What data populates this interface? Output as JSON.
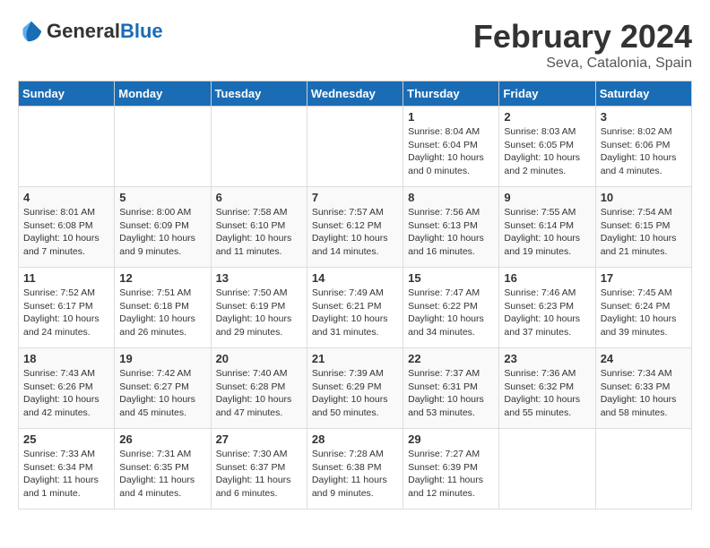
{
  "header": {
    "logo_general": "General",
    "logo_blue": "Blue",
    "title": "February 2024",
    "subtitle": "Seva, Catalonia, Spain"
  },
  "weekdays": [
    "Sunday",
    "Monday",
    "Tuesday",
    "Wednesday",
    "Thursday",
    "Friday",
    "Saturday"
  ],
  "weeks": [
    [
      {
        "day": "",
        "info": ""
      },
      {
        "day": "",
        "info": ""
      },
      {
        "day": "",
        "info": ""
      },
      {
        "day": "",
        "info": ""
      },
      {
        "day": "1",
        "info": "Sunrise: 8:04 AM\nSunset: 6:04 PM\nDaylight: 10 hours\nand 0 minutes."
      },
      {
        "day": "2",
        "info": "Sunrise: 8:03 AM\nSunset: 6:05 PM\nDaylight: 10 hours\nand 2 minutes."
      },
      {
        "day": "3",
        "info": "Sunrise: 8:02 AM\nSunset: 6:06 PM\nDaylight: 10 hours\nand 4 minutes."
      }
    ],
    [
      {
        "day": "4",
        "info": "Sunrise: 8:01 AM\nSunset: 6:08 PM\nDaylight: 10 hours\nand 7 minutes."
      },
      {
        "day": "5",
        "info": "Sunrise: 8:00 AM\nSunset: 6:09 PM\nDaylight: 10 hours\nand 9 minutes."
      },
      {
        "day": "6",
        "info": "Sunrise: 7:58 AM\nSunset: 6:10 PM\nDaylight: 10 hours\nand 11 minutes."
      },
      {
        "day": "7",
        "info": "Sunrise: 7:57 AM\nSunset: 6:12 PM\nDaylight: 10 hours\nand 14 minutes."
      },
      {
        "day": "8",
        "info": "Sunrise: 7:56 AM\nSunset: 6:13 PM\nDaylight: 10 hours\nand 16 minutes."
      },
      {
        "day": "9",
        "info": "Sunrise: 7:55 AM\nSunset: 6:14 PM\nDaylight: 10 hours\nand 19 minutes."
      },
      {
        "day": "10",
        "info": "Sunrise: 7:54 AM\nSunset: 6:15 PM\nDaylight: 10 hours\nand 21 minutes."
      }
    ],
    [
      {
        "day": "11",
        "info": "Sunrise: 7:52 AM\nSunset: 6:17 PM\nDaylight: 10 hours\nand 24 minutes."
      },
      {
        "day": "12",
        "info": "Sunrise: 7:51 AM\nSunset: 6:18 PM\nDaylight: 10 hours\nand 26 minutes."
      },
      {
        "day": "13",
        "info": "Sunrise: 7:50 AM\nSunset: 6:19 PM\nDaylight: 10 hours\nand 29 minutes."
      },
      {
        "day": "14",
        "info": "Sunrise: 7:49 AM\nSunset: 6:21 PM\nDaylight: 10 hours\nand 31 minutes."
      },
      {
        "day": "15",
        "info": "Sunrise: 7:47 AM\nSunset: 6:22 PM\nDaylight: 10 hours\nand 34 minutes."
      },
      {
        "day": "16",
        "info": "Sunrise: 7:46 AM\nSunset: 6:23 PM\nDaylight: 10 hours\nand 37 minutes."
      },
      {
        "day": "17",
        "info": "Sunrise: 7:45 AM\nSunset: 6:24 PM\nDaylight: 10 hours\nand 39 minutes."
      }
    ],
    [
      {
        "day": "18",
        "info": "Sunrise: 7:43 AM\nSunset: 6:26 PM\nDaylight: 10 hours\nand 42 minutes."
      },
      {
        "day": "19",
        "info": "Sunrise: 7:42 AM\nSunset: 6:27 PM\nDaylight: 10 hours\nand 45 minutes."
      },
      {
        "day": "20",
        "info": "Sunrise: 7:40 AM\nSunset: 6:28 PM\nDaylight: 10 hours\nand 47 minutes."
      },
      {
        "day": "21",
        "info": "Sunrise: 7:39 AM\nSunset: 6:29 PM\nDaylight: 10 hours\nand 50 minutes."
      },
      {
        "day": "22",
        "info": "Sunrise: 7:37 AM\nSunset: 6:31 PM\nDaylight: 10 hours\nand 53 minutes."
      },
      {
        "day": "23",
        "info": "Sunrise: 7:36 AM\nSunset: 6:32 PM\nDaylight: 10 hours\nand 55 minutes."
      },
      {
        "day": "24",
        "info": "Sunrise: 7:34 AM\nSunset: 6:33 PM\nDaylight: 10 hours\nand 58 minutes."
      }
    ],
    [
      {
        "day": "25",
        "info": "Sunrise: 7:33 AM\nSunset: 6:34 PM\nDaylight: 11 hours\nand 1 minute."
      },
      {
        "day": "26",
        "info": "Sunrise: 7:31 AM\nSunset: 6:35 PM\nDaylight: 11 hours\nand 4 minutes."
      },
      {
        "day": "27",
        "info": "Sunrise: 7:30 AM\nSunset: 6:37 PM\nDaylight: 11 hours\nand 6 minutes."
      },
      {
        "day": "28",
        "info": "Sunrise: 7:28 AM\nSunset: 6:38 PM\nDaylight: 11 hours\nand 9 minutes."
      },
      {
        "day": "29",
        "info": "Sunrise: 7:27 AM\nSunset: 6:39 PM\nDaylight: 11 hours\nand 12 minutes."
      },
      {
        "day": "",
        "info": ""
      },
      {
        "day": "",
        "info": ""
      }
    ]
  ]
}
